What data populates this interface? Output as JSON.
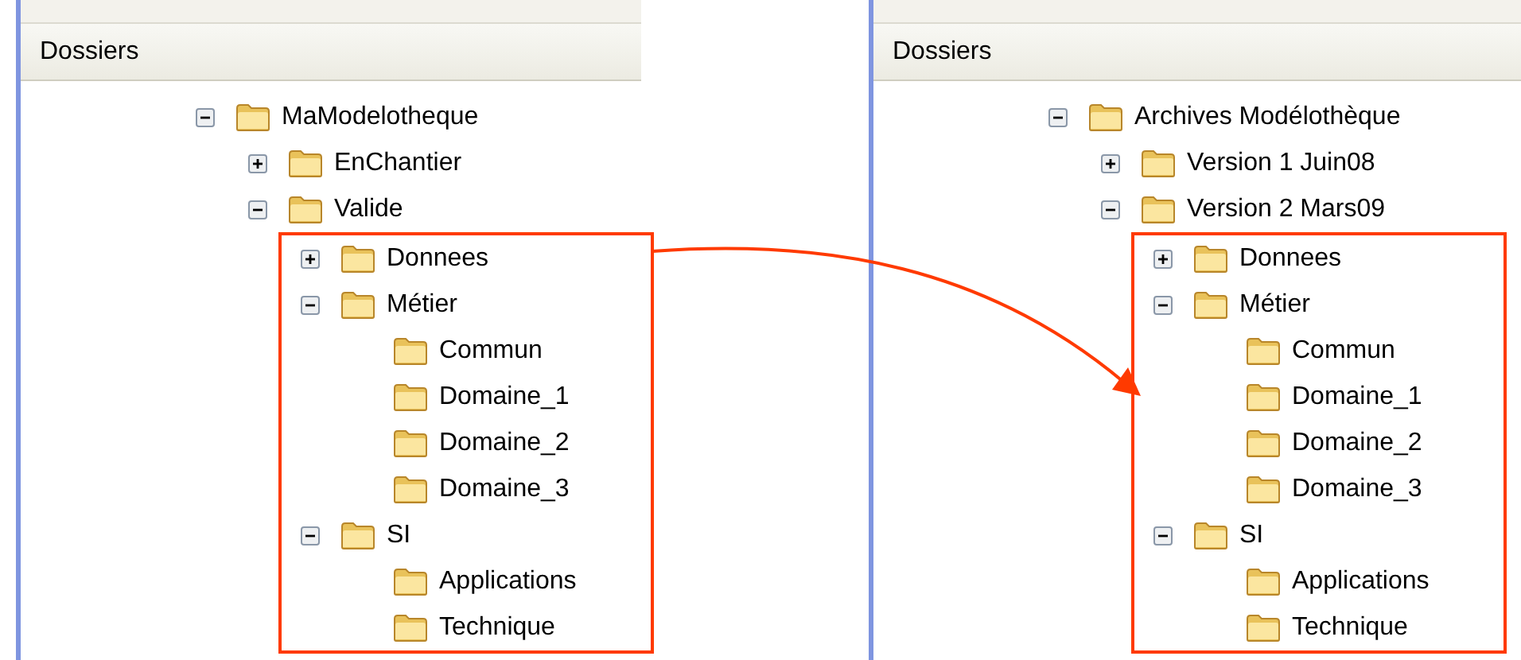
{
  "panes": [
    {
      "header": "Dossiers",
      "tree": [
        {
          "label": "MaModelotheque",
          "expanded": true,
          "children": [
            {
              "label": "EnChantier",
              "expanded": false
            },
            {
              "label": "Valide",
              "expanded": true,
              "framed": true,
              "children": [
                {
                  "label": "Donnees",
                  "expanded": false
                },
                {
                  "label": "Métier",
                  "expanded": true,
                  "children": [
                    {
                      "label": "Commun"
                    },
                    {
                      "label": "Domaine_1"
                    },
                    {
                      "label": "Domaine_2"
                    },
                    {
                      "label": "Domaine_3"
                    }
                  ]
                },
                {
                  "label": "SI",
                  "expanded": true,
                  "children": [
                    {
                      "label": "Applications"
                    },
                    {
                      "label": "Technique"
                    }
                  ]
                }
              ]
            }
          ]
        }
      ]
    },
    {
      "header": "Dossiers",
      "tree": [
        {
          "label": "Archives Modélothèque",
          "expanded": true,
          "children": [
            {
              "label": "Version 1 Juin08",
              "expanded": false
            },
            {
              "label": "Version 2 Mars09",
              "expanded": true,
              "framed": true,
              "children": [
                {
                  "label": "Donnees",
                  "expanded": false
                },
                {
                  "label": "Métier",
                  "expanded": true,
                  "children": [
                    {
                      "label": "Commun"
                    },
                    {
                      "label": "Domaine_1"
                    },
                    {
                      "label": "Domaine_2"
                    },
                    {
                      "label": "Domaine_3"
                    }
                  ]
                },
                {
                  "label": "SI",
                  "expanded": true,
                  "children": [
                    {
                      "label": "Applications"
                    },
                    {
                      "label": "Technique"
                    }
                  ]
                }
              ]
            }
          ]
        }
      ]
    }
  ]
}
